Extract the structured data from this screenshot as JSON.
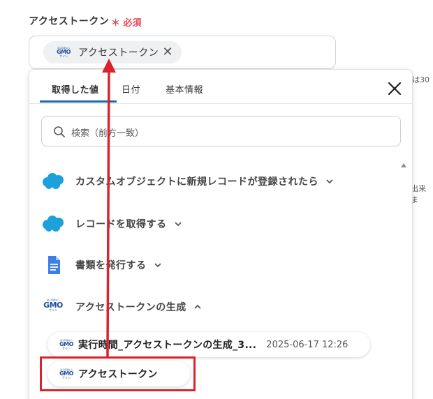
{
  "field": {
    "label": "アクセストークン",
    "required_mark": "＊",
    "required_text": "必須",
    "chip_label": "アクセストークン",
    "chip_close": "✕"
  },
  "logo": {
    "line1": "電子印鑑なら",
    "line2": "GMO",
    "line3": "サイン"
  },
  "background_fragments": {
    "top_right": "は30",
    "mid_right": "出来ま"
  },
  "dropdown": {
    "tabs": [
      {
        "label": "取得した値",
        "active": true
      },
      {
        "label": "日付",
        "active": false
      },
      {
        "label": "基本情報",
        "active": false
      }
    ],
    "search_placeholder": "検索（前方一致）",
    "steps": [
      {
        "icon": "salesforce-cloud-icon",
        "label": "カスタムオブジェクトに新規レコードが登録されたら",
        "expanded": false
      },
      {
        "icon": "salesforce-cloud-icon",
        "label": "レコードを取得する",
        "expanded": false
      },
      {
        "icon": "google-docs-icon",
        "label": "書類を発行する",
        "expanded": false
      },
      {
        "icon": "gmo-sign-logo-icon",
        "label": "アクセストークンの生成",
        "expanded": true
      }
    ],
    "items": [
      {
        "name": "実行時間_アクセストークンの生成_3...",
        "time": "2025-06-17 12:26"
      },
      {
        "name": "アクセストークン",
        "time": ""
      }
    ]
  },
  "colors": {
    "accent": "#1b6aa6",
    "required": "#e34b5a",
    "annotation": "#d9232d",
    "salesforce": "#1ea0db",
    "docs": "#3f7ee8"
  }
}
